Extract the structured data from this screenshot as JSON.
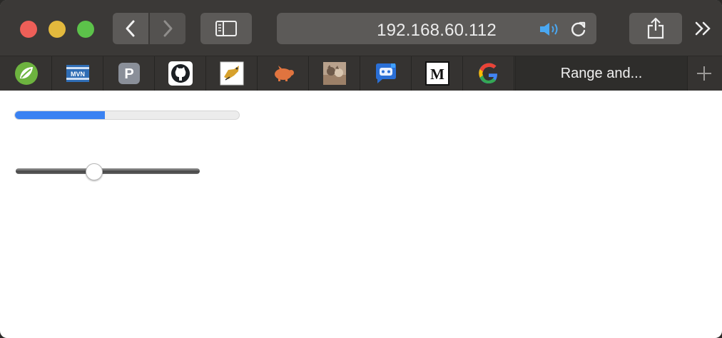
{
  "browser": {
    "url": "192.168.60.112",
    "active_tab_label": "Range and...",
    "colors": {
      "chrome": "#3b3937",
      "accent_blue": "#3a82f2"
    },
    "favorites": [
      {
        "name": "spring-icon"
      },
      {
        "name": "mvn-icon"
      },
      {
        "name": "p-letter-icon",
        "letter": "P"
      },
      {
        "name": "github-icon"
      },
      {
        "name": "tomcat-icon"
      },
      {
        "name": "pig-icon"
      },
      {
        "name": "photo-icon"
      },
      {
        "name": "chat-bot-icon"
      },
      {
        "name": "medium-icon",
        "letter": "M"
      },
      {
        "name": "google-icon"
      }
    ]
  },
  "page": {
    "progress": {
      "value_percent": 40
    },
    "slider": {
      "value_percent": 42
    }
  }
}
